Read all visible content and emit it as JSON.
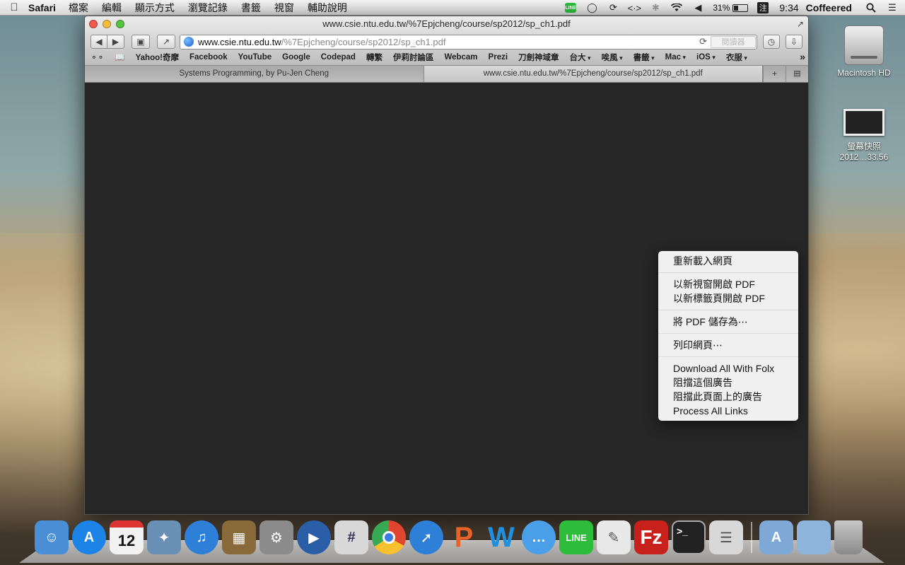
{
  "menubar": {
    "app_name": "Safari",
    "items": [
      "檔案",
      "編輯",
      "顯示方式",
      "瀏覽記錄",
      "書籤",
      "視窗",
      "輔助說明"
    ],
    "line_badge": "LINE",
    "battery": "31%",
    "input_method": "注",
    "clock": "9:34",
    "user": "Coffeered"
  },
  "window": {
    "title": "www.csie.ntu.edu.tw/%7Epjcheng/course/sp2012/sp_ch1.pdf",
    "url_host": "www.csie.ntu.edu.tw",
    "url_path": "/%7Epjcheng/course/sp2012/sp_ch1.pdf",
    "reader_label": "閱讀器",
    "bookmarks": [
      {
        "label": "Yahoo!奇摩",
        "dropdown": false
      },
      {
        "label": "Facebook",
        "dropdown": false
      },
      {
        "label": "YouTube",
        "dropdown": false
      },
      {
        "label": "Google",
        "dropdown": false
      },
      {
        "label": "Codepad",
        "dropdown": false
      },
      {
        "label": "轉繁",
        "dropdown": false
      },
      {
        "label": "伊莉討論區",
        "dropdown": false
      },
      {
        "label": "Webcam",
        "dropdown": false
      },
      {
        "label": "Prezi",
        "dropdown": false
      },
      {
        "label": "刀劍神域章",
        "dropdown": false
      },
      {
        "label": "台大",
        "dropdown": true
      },
      {
        "label": "唉風",
        "dropdown": true
      },
      {
        "label": "書籤",
        "dropdown": true
      },
      {
        "label": "Mac",
        "dropdown": true
      },
      {
        "label": "iOS",
        "dropdown": true
      },
      {
        "label": "衣服",
        "dropdown": true
      }
    ],
    "tabs": [
      {
        "label": "Systems Programming, by Pu-Jen Cheng",
        "active": false
      },
      {
        "label": "www.csie.ntu.edu.tw/%7Epjcheng/course/sp2012/sp_ch1.pdf",
        "active": true
      }
    ]
  },
  "context_menu": {
    "groups": [
      [
        "重新載入網頁"
      ],
      [
        "以新視窗開啟 PDF",
        "以新標籤頁開啟 PDF"
      ],
      [
        "將 PDF 儲存為⋯"
      ],
      [
        "列印網頁⋯"
      ],
      [
        "Download All With Folx",
        "阻擋這個廣告",
        "阻擋此頁面上的廣告",
        "Process All Links"
      ]
    ]
  },
  "desktop": {
    "hd_label": "Macintosh HD",
    "screenshot_label_1": "螢幕快照",
    "screenshot_label_2": "2012…33.56"
  },
  "dock": {
    "calendar_day": "12",
    "items": [
      {
        "name": "finder-icon",
        "color": "#4a8fd6"
      },
      {
        "name": "app-store-icon",
        "color": "#1b84e6"
      },
      {
        "name": "calendar-icon",
        "color": "#f2f2f2"
      },
      {
        "name": "preview-icon",
        "color": "#6a8fb4"
      },
      {
        "name": "itunes-icon",
        "color": "#2d7fd8"
      },
      {
        "name": "iphoto-icon",
        "color": "#8a6a3a"
      },
      {
        "name": "system-preferences-icon",
        "color": "#8b8b8b"
      },
      {
        "name": "quicktime-icon",
        "color": "#2a5fa8"
      },
      {
        "name": "hashtag-app-icon",
        "color": "#d8d8d8"
      },
      {
        "name": "chrome-icon",
        "color": "#e0452f"
      },
      {
        "name": "safari-icon",
        "color": "#2e7fd8"
      },
      {
        "name": "powerpoint-icon",
        "color": "#e8622a"
      },
      {
        "name": "word-icon",
        "color": "#1f8fe0"
      },
      {
        "name": "messages-icon",
        "color": "#4aa0e8"
      },
      {
        "name": "line-icon",
        "color": "#2ebd3a"
      },
      {
        "name": "textedit-icon",
        "color": "#e8e8e8"
      },
      {
        "name": "filezilla-icon",
        "color": "#c8211c"
      },
      {
        "name": "terminal-icon",
        "color": "#222222"
      },
      {
        "name": "notes-icon",
        "color": "#d8d8d8"
      }
    ]
  }
}
